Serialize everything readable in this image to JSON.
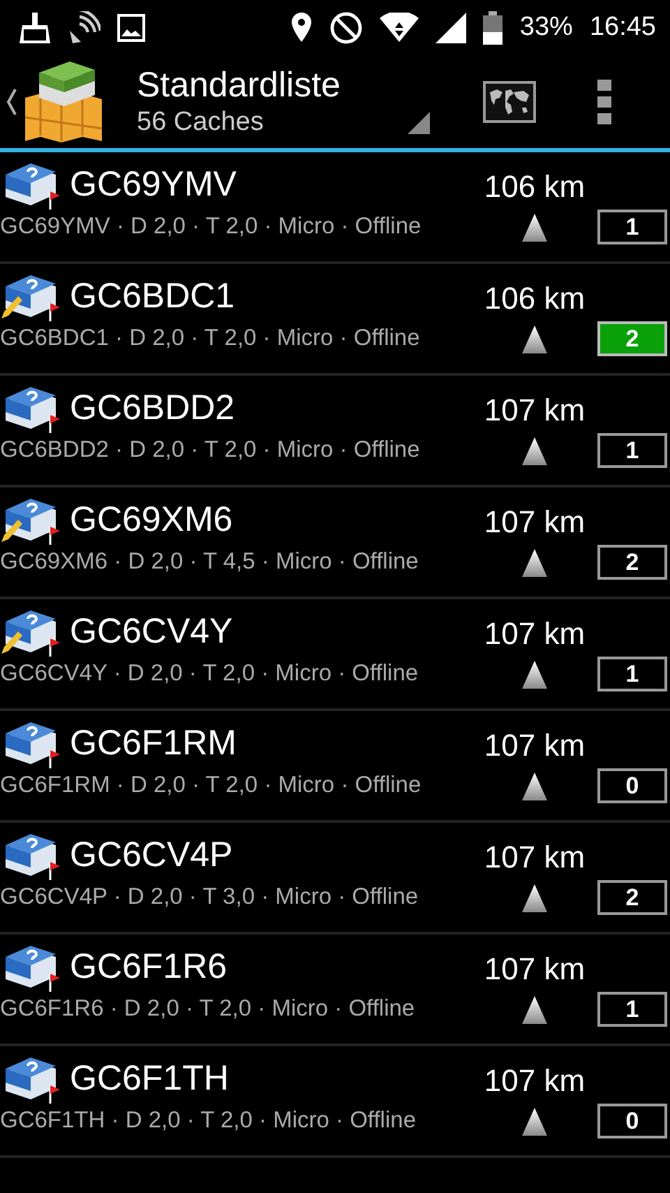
{
  "status_bar": {
    "battery": "33%",
    "time": "16:45"
  },
  "action_bar": {
    "title": "Standardliste",
    "subtitle": "56 Caches"
  },
  "caches": [
    {
      "name": "GC69YMV",
      "details": "GC69YMV · D 2,0 · T 2,0 · Micro · Offline",
      "distance": "106 km",
      "count": "1",
      "highlighted": false,
      "edited": false
    },
    {
      "name": "GC6BDC1",
      "details": "GC6BDC1 · D 2,0 · T 2,0 · Micro · Offline",
      "distance": "106 km",
      "count": "2",
      "highlighted": true,
      "edited": true
    },
    {
      "name": "GC6BDD2",
      "details": "GC6BDD2 · D 2,0 · T 2,0 · Micro · Offline",
      "distance": "107 km",
      "count": "1",
      "highlighted": false,
      "edited": false
    },
    {
      "name": "GC69XM6",
      "details": "GC69XM6 · D 2,0 · T 4,5 · Micro · Offline",
      "distance": "107 km",
      "count": "2",
      "highlighted": false,
      "edited": true
    },
    {
      "name": "GC6CV4Y",
      "details": "GC6CV4Y · D 2,0 · T 2,0 · Micro · Offline",
      "distance": "107 km",
      "count": "1",
      "highlighted": false,
      "edited": true
    },
    {
      "name": "GC6F1RM",
      "details": "GC6F1RM · D 2,0 · T 2,0 · Micro · Offline",
      "distance": "107 km",
      "count": "0",
      "highlighted": false,
      "edited": false
    },
    {
      "name": "GC6CV4P",
      "details": "GC6CV4P · D 2,0 · T 3,0 · Micro · Offline",
      "distance": "107 km",
      "count": "2",
      "highlighted": false,
      "edited": false
    },
    {
      "name": "GC6F1R6",
      "details": "GC6F1R6 · D 2,0 · T 2,0 · Micro · Offline",
      "distance": "107 km",
      "count": "1",
      "highlighted": false,
      "edited": false
    },
    {
      "name": "GC6F1TH",
      "details": "GC6F1TH · D 2,0 · T 2,0 · Micro · Offline",
      "distance": "107 km",
      "count": "0",
      "highlighted": false,
      "edited": false
    }
  ]
}
